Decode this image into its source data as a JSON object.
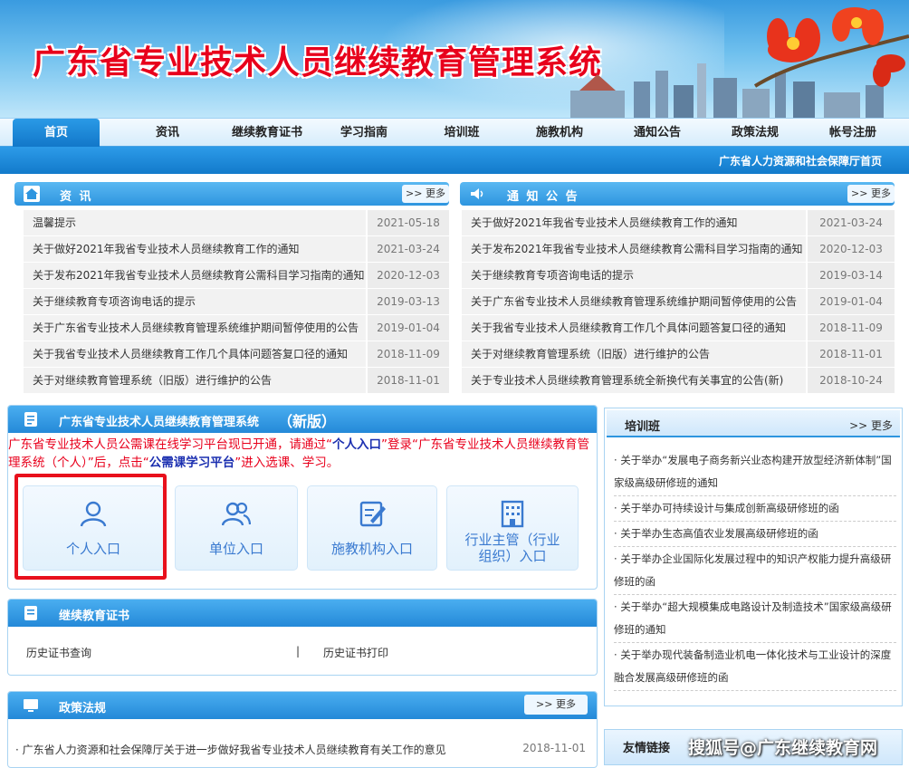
{
  "header": {
    "title": "广东省专业技术人员继续教育管理系统"
  },
  "nav": {
    "items": [
      "首页",
      "资讯",
      "继续教育证书",
      "学习指南",
      "培训班",
      "施教机构",
      "通知公告",
      "政策法规",
      "帐号注册"
    ]
  },
  "subbar": {
    "link": "广东省人力资源和社会保障厅首页"
  },
  "news": {
    "title": "资  讯",
    "more": ">> 更多",
    "items": [
      {
        "t": "温馨提示",
        "d": "2021-05-18"
      },
      {
        "t": "关于做好2021年我省专业技术人员继续教育工作的通知",
        "d": "2021-03-24"
      },
      {
        "t": "关于发布2021年我省专业技术人员继续教育公需科目学习指南的通知",
        "d": "2020-12-03"
      },
      {
        "t": "关于继续教育专项咨询电话的提示",
        "d": "2019-03-13"
      },
      {
        "t": "关于广东省专业技术人员继续教育管理系统维护期间暂停使用的公告",
        "d": "2019-01-04"
      },
      {
        "t": "关于我省专业技术人员继续教育工作几个具体问题答复口径的通知",
        "d": "2018-11-09"
      },
      {
        "t": "关于对继续教育管理系统（旧版）进行维护的公告",
        "d": "2018-11-01"
      }
    ]
  },
  "notices": {
    "title": "通 知 公 告",
    "more": ">> 更多",
    "items": [
      {
        "t": "关于做好2021年我省专业技术人员继续教育工作的通知",
        "d": "2021-03-24"
      },
      {
        "t": "关于发布2021年我省专业技术人员继续教育公需科目学习指南的通知",
        "d": "2020-12-03"
      },
      {
        "t": "关于继续教育专项咨询电话的提示",
        "d": "2019-03-14"
      },
      {
        "t": "关于广东省专业技术人员继续教育管理系统维护期间暂停使用的公告",
        "d": "2019-01-04"
      },
      {
        "t": "关于我省专业技术人员继续教育工作几个具体问题答复口径的通知",
        "d": "2018-11-09"
      },
      {
        "t": "关于对继续教育管理系统（旧版）进行维护的公告",
        "d": "2018-11-01"
      },
      {
        "t": "关于专业技术人员继续教育管理系统全新换代有关事宜的公告(新)",
        "d": "2018-10-24"
      }
    ]
  },
  "newsystem": {
    "title": "广东省专业技术人员继续教育管理系统",
    "badge": "（新版）",
    "notice_a": "广东省专业技术人员公需课在线学习平台现已开通，请通过“",
    "notice_b": "个人入口",
    "notice_c": "”登录“广东省专业技术人员继续教育管理系统（个人）”后，点击“",
    "notice_d": "公需课学习平台",
    "notice_e": "”进入选课、学习。",
    "entries": [
      "个人入口",
      "单位入口",
      "施教机构入口",
      "行业主管（行业组织）入口"
    ]
  },
  "cert": {
    "title": "继续教育证书",
    "links": [
      "历史证书查询",
      "|",
      "历史证书打印"
    ]
  },
  "policy": {
    "title": "政策法规",
    "more": ">> 更多",
    "items": [
      {
        "t": "· 广东省人力资源和社会保障厅关于进一步做好我省专业技术人员继续教育有关工作的意见",
        "d": "2018-11-01"
      }
    ]
  },
  "training": {
    "title": "培训班",
    "more": ">> 更多",
    "items": [
      "· 关于举办“发展电子商务新兴业态构建开放型经济新体制”国家级高级研修班的通知",
      "· 关于举办可持续设计与集成创新高级研修班的函",
      "· 关于举办生态高值农业发展高级研修班的函",
      "· 关于举办企业国际化发展过程中的知识产权能力提升高级研修班的函",
      "· 关于举办“超大规模集成电路设计及制造技术”国家级高级研修班的通知",
      "· 关于举办现代装备制造业机电一体化技术与工业设计的深度融合发展高级研修班的函"
    ]
  },
  "links": {
    "title": "友情链接"
  },
  "watermark": "搜狐号@广东继续教育网"
}
